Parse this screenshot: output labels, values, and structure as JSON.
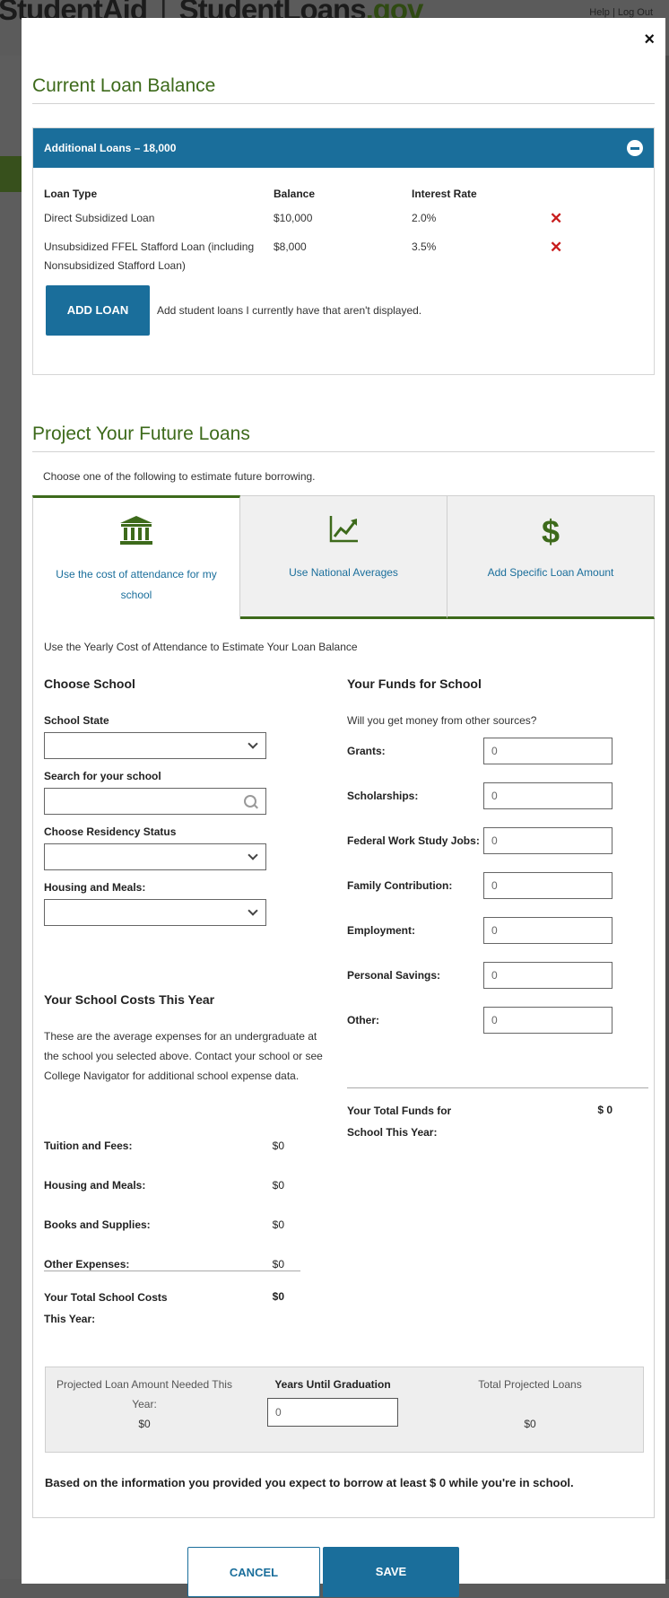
{
  "site": {
    "logo_student": "Student",
    "logo_aid": "Aid",
    "logo_loans": "StudentLoans",
    "logo_gov": ".gov",
    "util_links": "Help  |  Log Out"
  },
  "modal": {
    "close_label": "×",
    "current_section_title": "Current Loan Balance",
    "accordion_title": "Additional Loans – 18,000",
    "loan_table": {
      "headers": [
        "Loan Type",
        "Balance",
        "Interest Rate"
      ],
      "rows": [
        {
          "type": "Direct Subsidized Loan",
          "balance": "$10,000",
          "rate": "2.0%"
        },
        {
          "type": "Unsubsidized FFEL Stafford Loan (including Nonsubsidized Stafford Loan)",
          "balance": "$8,000",
          "rate": "3.5%"
        }
      ],
      "delete_icon": "✕"
    },
    "add_loan_button": "ADD LOAN",
    "add_loan_note": "Add student loans I currently have that aren't displayed.",
    "future_section_title": "Project Your Future Loans",
    "future_intro": "Choose one of the following to estimate future borrowing.",
    "tabs": [
      {
        "label": "Use the cost of attendance for my school",
        "icon": "bank-icon"
      },
      {
        "label": "Use National Averages",
        "icon": "trend-chart-icon"
      },
      {
        "label": "Add Specific Loan Amount",
        "icon": "dollar-icon"
      }
    ],
    "panel": {
      "intro": "Use the Yearly Cost of Attendance to Estimate Your Loan Balance",
      "choose_school_title": "Choose School",
      "school_state_label": "School State",
      "search_label": "Search for your school",
      "search_value": "",
      "residency_label": "Choose Residency Status",
      "housing_label": "Housing and Meals:",
      "costs_title": "Your School Costs This Year",
      "costs_description": "These are the average expenses for an undergraduate at the school you selected above. Contact your school or see College Navigator for additional school expense data.",
      "cost_rows": [
        {
          "label": "Tuition and Fees:",
          "value": "$0"
        },
        {
          "label": "Housing and Meals:",
          "value": "$0"
        },
        {
          "label": "Books and Supplies:",
          "value": "$0"
        },
        {
          "label": "Other Expenses:",
          "value": "$0"
        }
      ],
      "total_costs_label": "Your Total School Costs This Year:",
      "total_costs_value": "$0",
      "funds_title": "Your Funds for School",
      "funds_question": "Will you get money from other sources?",
      "fund_rows": [
        {
          "label": "Grants:",
          "value": "0"
        },
        {
          "label": "Scholarships:",
          "value": "0"
        },
        {
          "label": "Federal Work Study Jobs:",
          "value": "0"
        },
        {
          "label": "Family Contribution:",
          "value": "0"
        },
        {
          "label": "Employment:",
          "value": "0"
        },
        {
          "label": "Personal Savings:",
          "value": "0"
        },
        {
          "label": "Other:",
          "value": "0"
        }
      ],
      "total_funds_label": "Your Total Funds for School This Year:",
      "total_funds_value": "$ 0"
    },
    "summary": {
      "projected_label": "Projected Loan Amount Needed This Year:",
      "projected_value": "$0",
      "years_label": "Years Until Graduation",
      "years_value": "0",
      "total_label": "Total Projected Loans",
      "total_value": "$0"
    },
    "borrow_statement": "Based on the information you provided you expect to borrow at least $ 0 while you're in school.",
    "cancel_button": "CANCEL",
    "save_button": "SAVE"
  }
}
